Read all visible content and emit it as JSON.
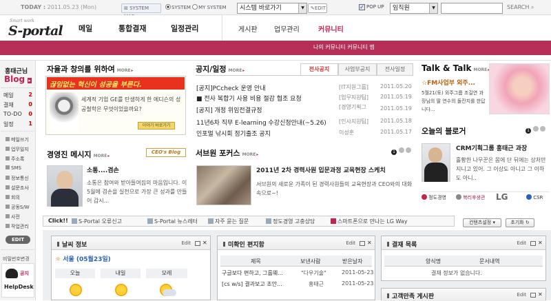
{
  "topbar": {
    "today_label": "TODAY :",
    "date": "2011.05.23 (Mon)",
    "system_map": "SYSTEM MAP",
    "system": "SYSTEM",
    "my_system": "MY SYSTEM",
    "shortcut_select": "시스템 바로가기",
    "edit_label": "EDIT",
    "popup_label": "POP UP",
    "search_scope": "임직원",
    "search_placeholder": "",
    "search_button": "SEARCH"
  },
  "header": {
    "logo_small": "Smart work",
    "logo": "S-portal",
    "main_nav": [
      "메일",
      "통합결재",
      "일정관리"
    ],
    "sub_nav": [
      "게시판",
      "업무관리",
      "커뮤니티"
    ],
    "community_sub": "나의 커뮤니티    커뮤니티 맵"
  },
  "sidebar": {
    "user": "홍태근님",
    "blog": "Blog",
    "counts": [
      {
        "label": "메일",
        "value": "2"
      },
      {
        "label": "결재",
        "value": "0"
      },
      {
        "label": "TO-DO",
        "value": "0"
      },
      {
        "label": "일정",
        "value": "1"
      }
    ],
    "menu": [
      "메일쓰기",
      "업무일지",
      "주소록",
      "SMS",
      "정보통신",
      "설문조사",
      "회의",
      "공동S/W",
      "사전",
      "작업관리"
    ],
    "edit": "EDIT",
    "password": "비밀번호변경",
    "helpdesk_top": "공지",
    "helpdesk": "HelpDesk"
  },
  "creativity": {
    "title": "자율과 창의를 위하여",
    "more": "MORE",
    "banner_title": "끊임없는 혁신이 성공을 부른다.",
    "banner_text": "세계적 기업 GE를 탄생하게 한 에디슨의 성공철학은 무엇이었을까요?",
    "banner_button": "이야기 바로가기"
  },
  "notice": {
    "title": "공지/일정",
    "more": "MORE",
    "tabs": [
      "전사공지",
      "사업부공지",
      "전사일정"
    ],
    "items": [
      {
        "title": "[공지]PCcheck 운영 안내",
        "dept": "[IT지원그룹]",
        "date": "2011.05.20"
      },
      {
        "title": "■ 전사 복합기 사용 비용 절감 협조 요청",
        "dept": "[업무지원팀]",
        "date": "2011.05.19"
      },
      {
        "title": "[공지] 개정 위임전결규정",
        "dept": "[경영기획그",
        "date": "2011.05.19"
      },
      {
        "title": "11년6차 직무 E-learning 수강신청안내(~5.26)",
        "dept": "[인사지원팀]",
        "date": "2011.05.18"
      },
      {
        "title": "인포멀 낚시회 정기출조 공지",
        "dept": "이성훈",
        "date": "2011.05.17"
      }
    ]
  },
  "talk": {
    "title": "Talk & Talk",
    "more": "MORE",
    "headline": "☆FM사업부 외주...",
    "text": "5월21(토) 외주그룹 조길연 과장님의 딸 연수의 돌잔치를 한답니다..."
  },
  "ceo": {
    "title": "경영진 메시지",
    "more": "MORE",
    "blog_btn": "CEO's Blog",
    "headline": "소통....겸손",
    "text": "소통은 참여와 받아들여짐의 마음입니다. 이 5월에 겸손을 실천으로 가장 큰 성과를 만들어 갑시..."
  },
  "service": {
    "title": "서브원 포커스",
    "more": "MORE",
    "headline": "2011년 2차 경력사원 입문과정 교육현장 스케치",
    "text": "서브원의 새로운 가족이 된 경력사원들의 교육현장과 CEO와의 대화 속으로~!"
  },
  "blogger": {
    "title": "오늘의 블로거",
    "headline": "CRM기획그룹 홍태근 과장",
    "text": "홀황한 나무꾼은 몸에 단 뒤에는 상처만 지니고 있어. 그 이상도 아니고 그 이하도 아니..",
    "logos": [
      "정도경영",
      "복리후생관",
      "LG",
      "CSR"
    ]
  },
  "quicklinks": {
    "click": "Click!!",
    "items": [
      "S-Portal 오류신고",
      "S-Portal 뉴스레터",
      "자주 묻는 질문",
      "정도경영 고충상담",
      "스마트폰으로 만나는 LG Way"
    ],
    "settings": "컨텐츠설정",
    "reset": "초기화"
  },
  "weather": {
    "title": "날씨 정보",
    "edit": "Edit",
    "location": "서울 (05월23일)",
    "days": [
      "오늘",
      "내일",
      "모레"
    ]
  },
  "unread": {
    "title": "미확인 편지함",
    "edit": "Edit",
    "headers": [
      "제목",
      "보낸사람",
      "받은날자"
    ],
    "rows": [
      {
        "subject": "구글보다 편하고, 그룹웨...",
        "sender": "\"다우기술\"",
        "date": "2011-05-23"
      },
      {
        "subject": "[cs w/s] 결과보고 초안...",
        "sender": "홍태근",
        "date": "2011-05-23"
      }
    ]
  },
  "approval": {
    "title": "결재 목록",
    "edit": "Edit",
    "headers": [
      "양식명",
      "문서내역"
    ],
    "empty": "결재 정보가 없습니다."
  },
  "satisfaction": {
    "title": "고객만족 게시판",
    "edit": "Edit"
  }
}
